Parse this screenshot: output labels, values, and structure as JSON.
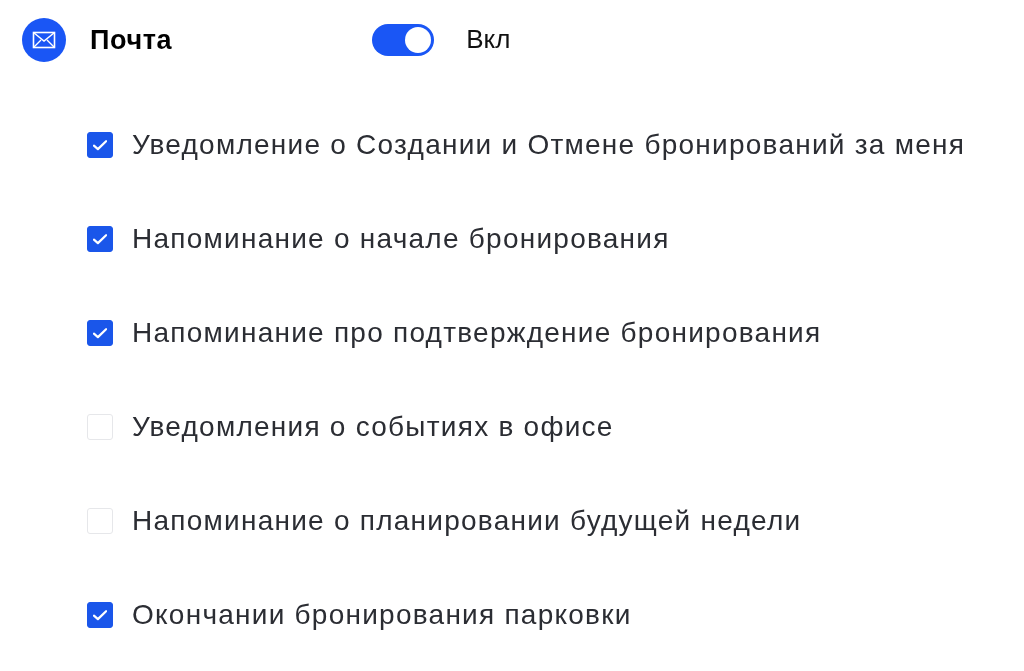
{
  "section": {
    "title": "Почта",
    "toggle": {
      "on": true,
      "label": "Вкл"
    }
  },
  "options": [
    {
      "label": "Уведомление о Создании и Отмене бронирований за меня",
      "checked": true
    },
    {
      "label": "Напоминание о начале бронирования",
      "checked": true
    },
    {
      "label": "Напоминание про подтверждение бронирования",
      "checked": true
    },
    {
      "label": "Уведомления о событиях в офисе",
      "checked": false
    },
    {
      "label": "Напоминание о планировании будущей недели",
      "checked": false
    },
    {
      "label": "Окончании бронирования парковки",
      "checked": true
    }
  ]
}
